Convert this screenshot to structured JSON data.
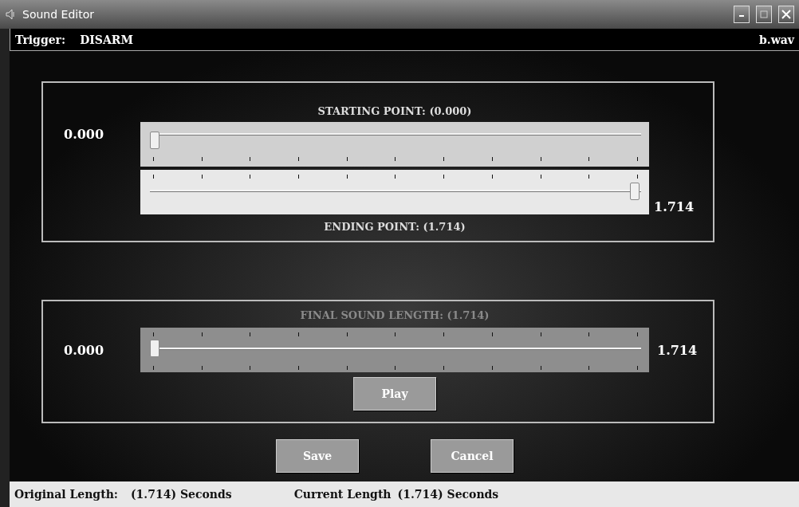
{
  "window": {
    "title": "Sound Editor"
  },
  "header": {
    "trigger_label": "Trigger:",
    "trigger_value": "DISARM",
    "file": "b.wav"
  },
  "range_panel": {
    "start_title": "STARTING POINT: (0.000)",
    "end_title": "ENDING POINT: (1.714)",
    "start_reading": "0.000",
    "end_reading": "1.714",
    "sliders": [
      {
        "kind": "ticks_below",
        "level": 0
      },
      {
        "kind": "ticks_above",
        "level": 1
      }
    ]
  },
  "length_panel": {
    "title": "FINAL SOUND LENGTH: (1.714)",
    "disabled": true,
    "min_reading": "0.000",
    "max_reading": "1.714",
    "slider": {
      "kind": "ticks_both",
      "level": 0
    },
    "play_button": "Play"
  },
  "buttons": [
    "Save",
    "Cancel"
  ],
  "status_bar": {
    "original_label": "Original Length:",
    "original_value": "(1.714) Seconds",
    "current_label": "Current Length",
    "current_value": "(1.714) Seconds"
  }
}
